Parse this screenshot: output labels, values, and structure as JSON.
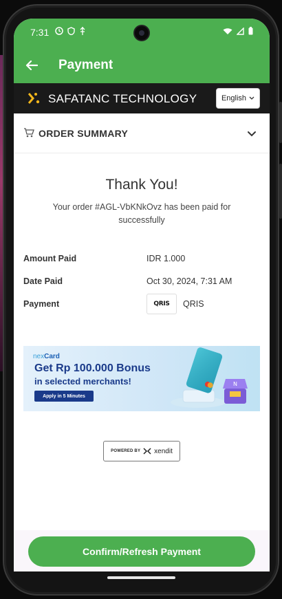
{
  "status_bar": {
    "time": "7:31"
  },
  "app_bar": {
    "title": "Payment"
  },
  "merchant": {
    "name": "SAFATANC TECHNOLOGY",
    "language": "English"
  },
  "order_summary": {
    "label": "ORDER SUMMARY"
  },
  "confirmation": {
    "heading": "Thank You!",
    "message": "Your order #AGL-VbKNkOvz has been paid for successfully"
  },
  "details": [
    {
      "label": "Amount Paid",
      "value": "IDR 1.000"
    },
    {
      "label": "Date Paid",
      "value": "Oct 30, 2024, 7:31 AM"
    },
    {
      "label": "Payment",
      "value": "QRIS",
      "logo_text": "QRIS"
    }
  ],
  "banner": {
    "brand_prefix": "nex",
    "brand_suffix": "Card",
    "title": "Get Rp 100.000 Bonus",
    "subtitle": "in selected merchants!",
    "cta": "Apply in 5 Minutes"
  },
  "footer_badge": {
    "powered": "POWERED BY",
    "provider": "xendit"
  },
  "confirm_button": {
    "label": "Confirm/Refresh Payment"
  },
  "colors": {
    "primary": "#4caf50",
    "merchant_bar": "#1a1a1a",
    "banner_navy": "#1a3a8a"
  }
}
